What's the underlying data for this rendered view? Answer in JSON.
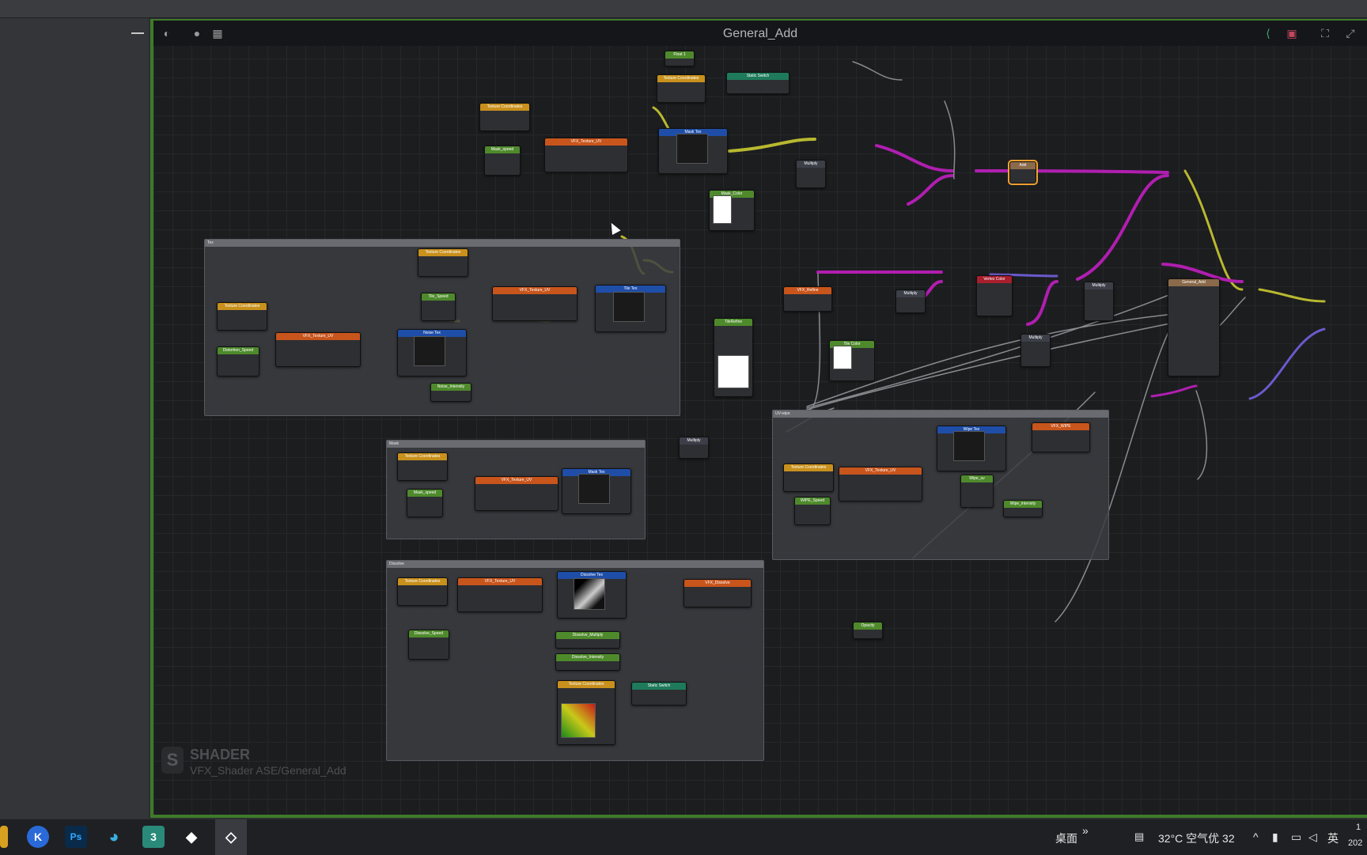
{
  "canvas": {
    "title": "General_Add"
  },
  "watermark": {
    "title": "SHADER",
    "subtitle": "VFX_Shader ASE/General_Add"
  },
  "groups": [
    {
      "label": "Tex"
    },
    {
      "label": "Mask"
    },
    {
      "label": "Dissolve"
    },
    {
      "label": "UV-wipe"
    }
  ],
  "nodes": {
    "float1": "Float 1",
    "static_switch_top": "Static Switch",
    "tex_coord": "Texture Coordinates",
    "vfx_texture_uv": "VFX_Texture_UV",
    "mask_tex": "Mask Tex",
    "mask_speed": "Mask_speed",
    "mask_color": "Mask_Color",
    "multiply": "Multiply",
    "add": "Add",
    "tile_speed": "Tile_Speed",
    "tile_tex": "Tile Tex",
    "vfx_refine": "VFX_Refine",
    "noise_tex": "Noise Tex",
    "noise_speed": "Distortion_Speed",
    "noise_intensity": "Noise_Intensity",
    "tile_refine": "TileRefine",
    "vertex_color": "Vertex Color",
    "tile_color": "Tile Color",
    "general_add": "General_Add",
    "wipe_tex": "Wipe Tex",
    "vfx_wipe": "VFX_WIPE",
    "wipe_speed": "WIPE_Speed",
    "wipe_uv": "Wipe_uv",
    "wipe_intensity": "Wipe_intensity",
    "dissolve_tex": "Dissolve Tex",
    "vfx_dissolve": "VFX_Dissolve",
    "dissolve_speed": "Dissolve_Speed",
    "dissolve_multiply": "Dissolve_Multiply",
    "dissolve_intensity": "Dissolve_Intensity",
    "static_switch": "Static Switch",
    "opacity": "Opacity"
  },
  "taskbar": {
    "desktop": "桌面",
    "chevron": "»",
    "weather": "32°C 空气优 32",
    "ime": "英",
    "clock_top": "1",
    "clock_bottom": "202"
  },
  "colors": {
    "frame_border": "#3f7a2a",
    "wire_purple": "#b01eb0",
    "wire_yellow": "#b8b830"
  }
}
